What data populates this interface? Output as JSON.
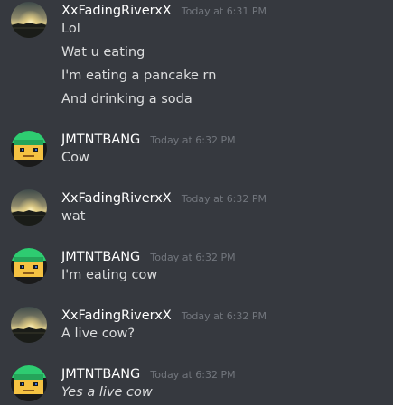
{
  "users": {
    "river": {
      "name": "XxFadingRiverxX"
    },
    "jmt": {
      "name": "JMTNTBANG"
    }
  },
  "messages": [
    {
      "author": "XxFadingRiverxX",
      "time": "Today at 6:31 PM",
      "lines": [
        "Lol",
        "Wat u eating",
        "I'm eating a pancake rn",
        "And drinking a soda"
      ]
    },
    {
      "author": "JMTNTBANG",
      "time": "Today at 6:32 PM",
      "lines": [
        "Cow"
      ]
    },
    {
      "author": "XxFadingRiverxX",
      "time": "Today at 6:32 PM",
      "lines": [
        "wat"
      ]
    },
    {
      "author": "JMTNTBANG",
      "time": "Today at 6:32 PM",
      "lines": [
        "I'm eating cow"
      ]
    },
    {
      "author": "XxFadingRiverxX",
      "time": "Today at 6:32 PM",
      "lines": [
        "A live cow?"
      ]
    },
    {
      "author": "JMTNTBANG",
      "time": "Today at 6:32 PM",
      "lines": [
        "Yes a live cow"
      ]
    }
  ],
  "colors": {
    "background": "#36393f",
    "username": "#ffffff",
    "timestamp": "#72767d",
    "message_text": "#dcddde",
    "pixel_avatar_green": "#2ecc71",
    "pixel_avatar_skin": "#f5c242"
  }
}
